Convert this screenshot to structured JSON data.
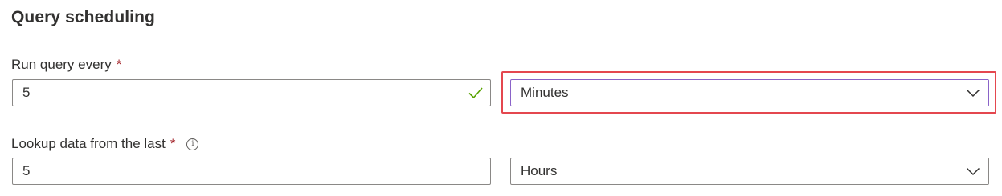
{
  "section": {
    "title": "Query scheduling"
  },
  "run_query": {
    "label": "Run query every",
    "required_marker": "*",
    "value": "5",
    "valid": true,
    "unit_selected": "Minutes",
    "unit_highlighted": true
  },
  "lookup": {
    "label": "Lookup data from the last",
    "required_marker": "*",
    "info_icon": "info-icon",
    "info_glyph": "i",
    "value": "5",
    "unit_selected": "Hours"
  },
  "colors": {
    "required": "#a4262c",
    "valid_check": "#57a300",
    "focus_border": "#8a63c8",
    "highlight": "#e4474f"
  }
}
